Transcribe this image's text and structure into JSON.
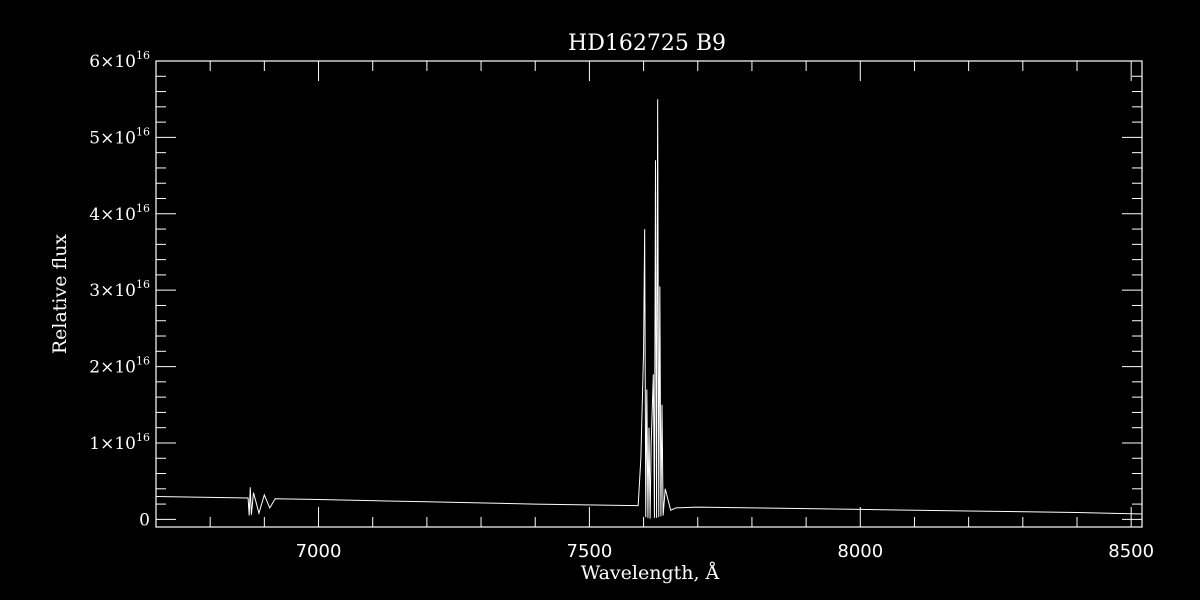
{
  "chart_data": {
    "type": "line",
    "title": "HD162725  B9",
    "xlabel": "Wavelength, Å",
    "ylabel": "Relative flux",
    "xlim": [
      6700,
      8520
    ],
    "ylim": [
      -1000000000000000.0,
      6e+16
    ],
    "x_ticks": [
      7000,
      7500,
      8000,
      8500
    ],
    "x_tick_labels": [
      "7000",
      "7500",
      "8000",
      "8500"
    ],
    "y_ticks": [
      0,
      1e+16,
      2e+16,
      3e+16,
      4e+16,
      5e+16,
      6e+16
    ],
    "y_tick_labels": [
      {
        "mantissa": "0",
        "exponent": ""
      },
      {
        "mantissa": "1×10",
        "exponent": "16"
      },
      {
        "mantissa": "2×10",
        "exponent": "16"
      },
      {
        "mantissa": "3×10",
        "exponent": "16"
      },
      {
        "mantissa": "4×10",
        "exponent": "16"
      },
      {
        "mantissa": "5×10",
        "exponent": "16"
      },
      {
        "mantissa": "6×10",
        "exponent": "16"
      }
    ],
    "grid": false,
    "series": [
      {
        "color": "#ffffff",
        "x": [
          6700,
          6870,
          6872,
          6874,
          6876,
          6880,
          6890,
          6900,
          6910,
          6920,
          7000,
          7200,
          7400,
          7590,
          7595,
          7600,
          7602,
          7604,
          7606,
          7608,
          7610,
          7612,
          7614,
          7618,
          7620,
          7622,
          7624,
          7626,
          7628,
          7630,
          7632,
          7634,
          7636,
          7640,
          7650,
          7660,
          7700,
          7800,
          8000,
          8200,
          8400,
          8520
        ],
        "y": [
          3000000000000000.0,
          2800000000000000.0,
          500000000000000.0,
          4200000000000000.0,
          600000000000000.0,
          3500000000000000.0,
          800000000000000.0,
          3200000000000000.0,
          1500000000000000.0,
          2700000000000000.0,
          2600000000000000.0,
          2300000000000000.0,
          2000000000000000.0,
          1800000000000000.0,
          8000000000000000.0,
          2.2e+16,
          3.8e+16,
          300000000000000.0,
          1.7e+16,
          200000000000000.0,
          1.2e+16,
          100000000000000.0,
          1e+16,
          1.9e+16,
          200000000000000.0,
          4.7e+16,
          200000000000000.0,
          5.5e+16,
          300000000000000.0,
          3.05e+16,
          400000000000000.0,
          1.5e+16,
          500000000000000.0,
          4000000000000000.0,
          1200000000000000.0,
          1500000000000000.0,
          1600000000000000.0,
          1500000000000000.0,
          1300000000000000.0,
          1100000000000000.0,
          900000000000000.0,
          700000000000000.0
        ]
      }
    ]
  }
}
